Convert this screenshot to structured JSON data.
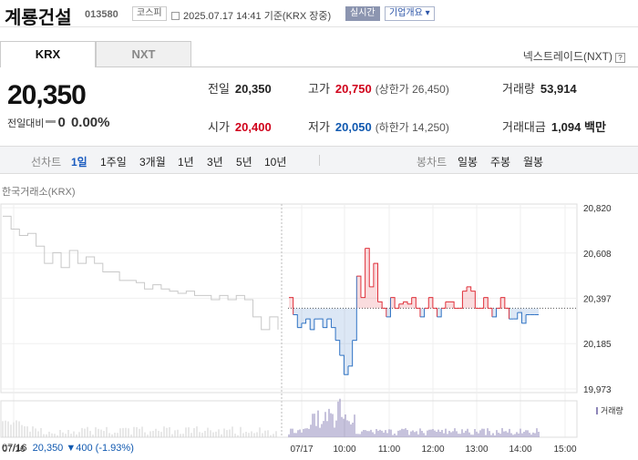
{
  "header": {
    "name": "계룡건설",
    "code": "013580",
    "market_badge": "코스피",
    "datetime": "2025.07.17 14:41 기준(KRX 장중)",
    "realtime_badge": "실시간",
    "company_info": "기업개요 ▾"
  },
  "tabs": [
    {
      "label": "KRX"
    },
    {
      "label": "NXT"
    }
  ],
  "nxt_link": "넥스트레이드(NXT)",
  "quote": {
    "price": "20,350",
    "change_label": "전일대비",
    "change_value": "0",
    "change_pct": "0.00%",
    "prev_label": "전일",
    "prev": "20,350",
    "high_label": "고가",
    "high": "20,750",
    "upper_limit": "(상한가 26,450)",
    "volume_label": "거래량",
    "volume": "53,914",
    "open_label": "시가",
    "open": "20,400",
    "low_label": "저가",
    "low": "20,050",
    "lower_limit": "(하한가 14,250)",
    "amount_label": "거래대금",
    "amount": "1,094 백만"
  },
  "period_bar": {
    "label": "선차트",
    "items": [
      "1일",
      "1주일",
      "3개월",
      "1년",
      "3년",
      "5년",
      "10년"
    ],
    "active": "1일",
    "candle_label": "봉차트",
    "candle_items": [
      "일봉",
      "주봉",
      "월봉"
    ]
  },
  "chart_data": {
    "type": "line",
    "source_label": "한국거래소(KRX)",
    "y_ticks": [
      "20,820",
      "20,608",
      "20,397",
      "20,185",
      "19,973"
    ],
    "ylim": [
      19973,
      20820
    ],
    "x_ticks": [
      "07/16",
      "07/17",
      "10:00",
      "11:00",
      "12:00",
      "13:00",
      "14:00",
      "15:00"
    ],
    "baseline": 20350,
    "volume_legend": "거래량",
    "prev_day_series": [
      20780,
      20720,
      20690,
      20700,
      20640,
      20560,
      20610,
      20540,
      20620,
      20560,
      20590,
      20560,
      20520,
      20520,
      20480,
      20480,
      20470,
      20440,
      20460,
      20440,
      20430,
      20420,
      20430,
      20410,
      20410,
      20390,
      20410,
      20390,
      20410,
      20390,
      20310,
      20250,
      20310,
      20250
    ],
    "today_series": [
      20400,
      20320,
      20260,
      20280,
      20300,
      20250,
      20300,
      20300,
      20260,
      20300,
      20260,
      20200,
      20130,
      20040,
      20080,
      20200,
      20500,
      20400,
      20630,
      20450,
      20560,
      20380,
      20350,
      20310,
      20400,
      20350,
      20370,
      20380,
      20370,
      20400,
      20350,
      20310,
      20350,
      20400,
      20350,
      20310,
      20350,
      20380,
      20380,
      20350,
      20350,
      20430,
      20450,
      20430,
      20350,
      20350,
      20400,
      20350,
      20310,
      20350,
      20400,
      20350,
      20300,
      20300,
      20330,
      20280,
      20320,
      20320,
      20320,
      20320
    ]
  },
  "footer": {
    "date": "07/16",
    "price": "20,350",
    "change": "▼400 (-1.93%)"
  }
}
